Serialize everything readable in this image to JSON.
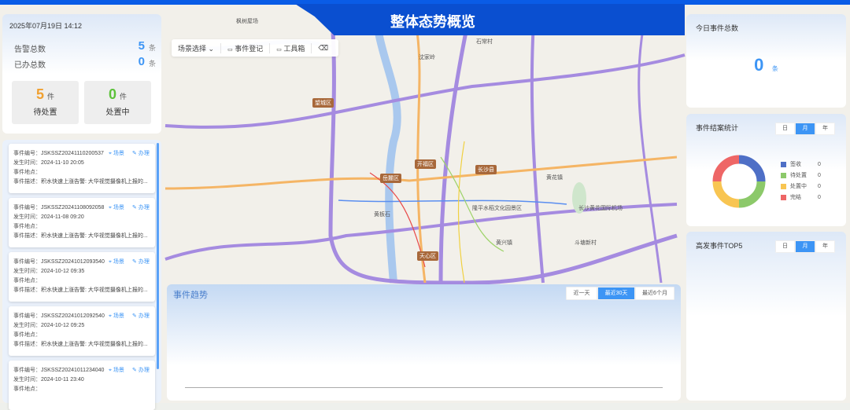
{
  "header": {
    "title": "整体态势概览"
  },
  "stats": {
    "datetime": "2025年07月19日 14:12",
    "alarm_label": "告警总数",
    "alarm_value": "5",
    "alarm_unit": "条",
    "done_label": "已办总数",
    "done_value": "0",
    "done_unit": "条",
    "pending": {
      "value": "5",
      "unit": "件",
      "label": "待处置",
      "color": "#f0a030"
    },
    "processing": {
      "value": "0",
      "unit": "件",
      "label": "处置中",
      "color": "#5cc23a"
    }
  },
  "events": [
    {
      "id_label": "事件编号：",
      "id": "JSKSSZ20241110200537",
      "time_label": "发生时间：",
      "time": "2024-11-10 20:05",
      "loc_label": "事件地点：",
      "desc_label": "事件描述：",
      "desc": "积水快速上涨告警: 大华视觉摄像机上报的...",
      "scene": "场景",
      "handle": "办理"
    },
    {
      "id_label": "事件编号：",
      "id": "JSKSSZ20241108092058",
      "time_label": "发生时间：",
      "time": "2024-11-08 09:20",
      "loc_label": "事件地点：",
      "desc_label": "事件描述：",
      "desc": "积水快速上涨告警: 大华视觉摄像机上报的...",
      "scene": "场景",
      "handle": "办理"
    },
    {
      "id_label": "事件编号：",
      "id": "JSKSSZ20241012093540",
      "time_label": "发生时间：",
      "time": "2024-10-12 09:35",
      "loc_label": "事件地点：",
      "desc_label": "事件描述：",
      "desc": "积水快速上涨告警: 大华视觉摄像机上报的...",
      "scene": "场景",
      "handle": "办理"
    },
    {
      "id_label": "事件编号：",
      "id": "JSKSSZ20241012092540",
      "time_label": "发生时间：",
      "time": "2024-10-12 09:25",
      "loc_label": "事件地点：",
      "desc_label": "事件描述：",
      "desc": "积水快速上涨告警: 大华视觉摄像机上报的...",
      "scene": "场景",
      "handle": "办理"
    },
    {
      "id_label": "事件编号：",
      "id": "JSKSSZ20241011234040",
      "time_label": "发生时间：",
      "time": "2024-10-11 23:40",
      "loc_label": "事件地点：",
      "scene": "场景",
      "handle": "办理"
    }
  ],
  "toolbar": {
    "scene_select": "场景选择",
    "register": "事件登记",
    "toolbox": "工具箱"
  },
  "map": {
    "labels": [
      "枫树屋场",
      "石常村",
      "沈家岭",
      "黄花镇",
      "黄板石",
      "黄兴镇",
      "斗塘新村",
      "隆平水稻文化园景区",
      "长沙黄花国际机场"
    ],
    "districts": [
      "开福区",
      "岳麓区",
      "长沙县",
      "天心区",
      "望城区"
    ]
  },
  "trend": {
    "title": "事件趋势",
    "tabs": [
      "近一天",
      "最近30天",
      "最近6个月"
    ],
    "active": 1
  },
  "today": {
    "title": "今日事件总数",
    "value": "0",
    "unit": "条"
  },
  "closure": {
    "title": "事件结案统计",
    "tabs": [
      "日",
      "月",
      "年"
    ],
    "active": 1,
    "legend": [
      {
        "label": "签收",
        "value": "0",
        "color": "#4e6fc6"
      },
      {
        "label": "待处置",
        "value": "0",
        "color": "#8cc96a"
      },
      {
        "label": "处置中",
        "value": "0",
        "color": "#f8c552"
      },
      {
        "label": "完结",
        "value": "0",
        "color": "#ee6666"
      }
    ]
  },
  "top5": {
    "title": "高发事件TOP5",
    "tabs": [
      "日",
      "月",
      "年"
    ],
    "active": 1
  }
}
